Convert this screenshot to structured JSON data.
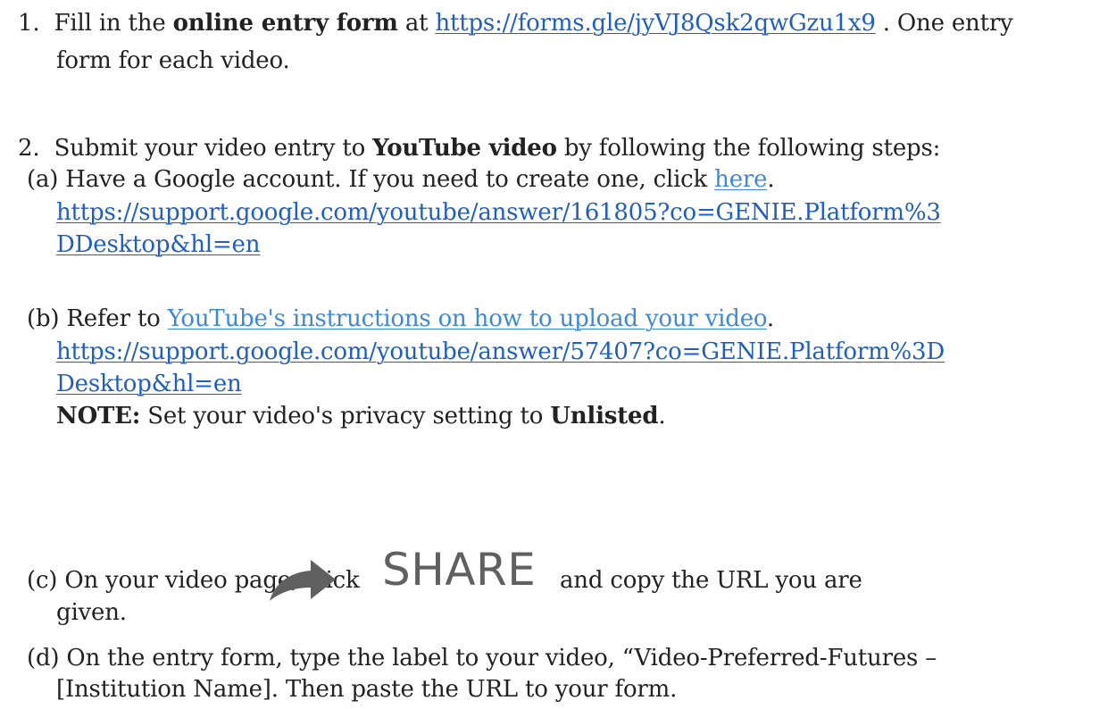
{
  "item1": {
    "number": "1.",
    "text_before": "Fill in the ",
    "bold": "online entry form",
    "text_mid": " at ",
    "link": "https://forms.gle/jyVJ8Qsk2qwGzu1x9",
    "text_after": " . One entry",
    "line2": "form for each video."
  },
  "item2": {
    "number": "2.",
    "text_before": "Submit your video entry to ",
    "bold": "YouTube video",
    "text_after": " by following the following steps:",
    "a": {
      "label": "(a)",
      "text": "Have a Google account. If you need to create one, click ",
      "here_link": "here",
      "period": ".",
      "url_line1": "https://support.google.com/youtube/answer/161805?co=GENIE.Platform%3",
      "url_line2": "DDesktop&hl=en"
    },
    "b": {
      "label": "(b)",
      "text": "Refer to ",
      "instr_link": "YouTube's instructions on how to upload your video",
      "period": ".",
      "url_line1": "https://support.google.com/youtube/answer/57407?co=GENIE.Platform%3D",
      "url_line2": "Desktop&hl=en",
      "note_label": "NOTE:",
      "note_text": " Set your video's privacy setting to ",
      "note_bold": "Unlisted",
      "note_end": "."
    },
    "c": {
      "label": "(c)",
      "text_before": "On your video page, click",
      "share_icon": "share-arrow-icon",
      "share_word": "SHARE",
      "text_after": "and copy the URL you are",
      "line2": "given."
    },
    "d": {
      "label": "(d)",
      "line1": "On the entry form, type the label to your video, “Video-Preferred-Futures –",
      "line2": "[Institution Name]. Then paste the URL to your form."
    }
  }
}
